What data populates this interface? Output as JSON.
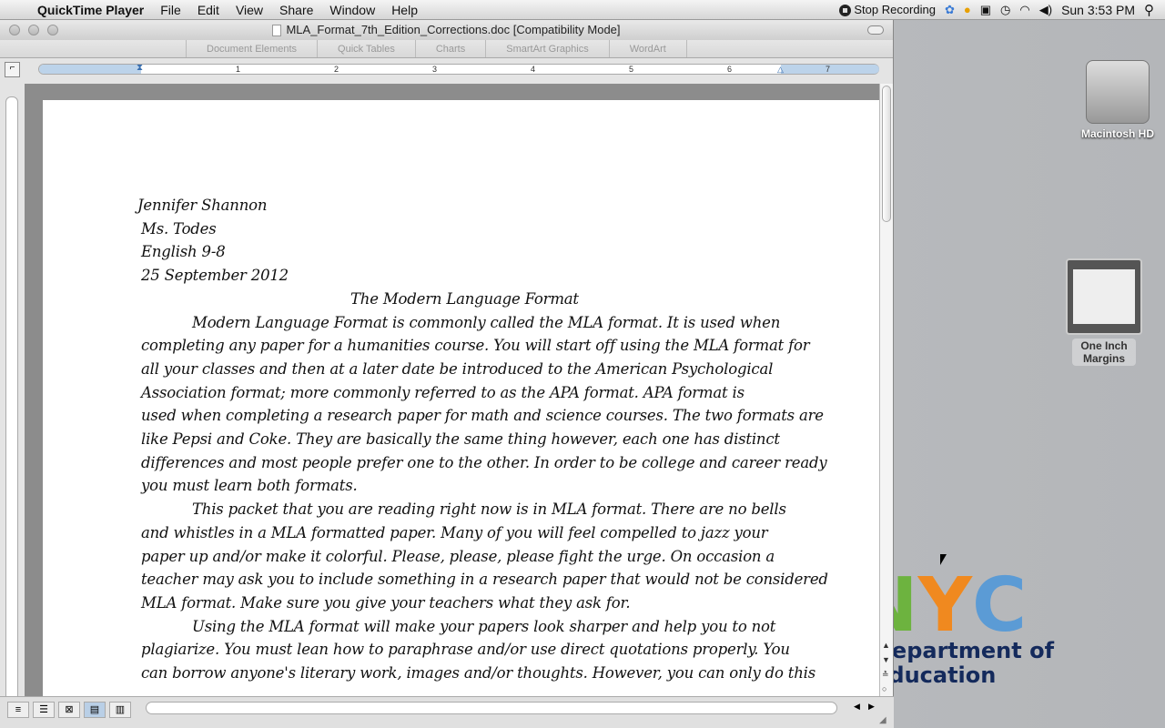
{
  "menubar": {
    "app": "QuickTime Player",
    "items": [
      "File",
      "Edit",
      "View",
      "Share",
      "Window",
      "Help"
    ],
    "stop_recording": "Stop Recording",
    "clock": "Sun 3:53 PM"
  },
  "window": {
    "title": "MLA_Format_7th_Edition_Corrections.doc [Compatibility Mode]",
    "ribbon_tabs": [
      "Document Elements",
      "Quick Tables",
      "Charts",
      "SmartArt Graphics",
      "WordArt"
    ],
    "ruler_numbers": [
      "1",
      "2",
      "3",
      "4",
      "5",
      "6",
      "7"
    ]
  },
  "document": {
    "lines": [
      "Jennifer Shannon",
      "Ms. Todes",
      "English  9-8",
      "25 September 2012",
      "The Modern Language Format",
      "Modern Language Format is commonly called the MLA format.  It is used when",
      "completing any paper for a humanities course.  You will start off using the MLA format for",
      "all your classes and then at a later date be introduced to the American Psychological",
      "Association format; more commonly referred to as the APA format.  APA format is",
      "used when completing a research paper for math and science courses.   The two formats are",
      "like Pepsi and Coke.  They are basically the same thing however, each one has distinct",
      "differences and most people prefer one to the other.  In order to be college and career ready",
      "you must learn both formats.",
      "This packet that you are reading right now is in MLA format.  There are no bells",
      "and whistles in a MLA formatted paper.   Many of you will feel compelled to jazz your",
      "paper up and/or make it colorful.  Please, please, please fight the urge.  On occasion a",
      "teacher may ask you to include something in a research paper that would not be considered",
      "MLA format.  Make sure you give your teachers what they ask for.",
      "Using the MLA format will make your papers look sharper and help you to not",
      "plagiarize. You must lean how to paraphrase and/or use direct quotations properly.  You",
      "can borrow anyone's literary work, images and/or thoughts.  However, you can only do this"
    ]
  },
  "desktop": {
    "hd": "Macintosh HD",
    "file": "One Inch Margins",
    "nyc": {
      "letters": [
        "N",
        "Y",
        "C"
      ],
      "colors": [
        "#6db33f",
        "#f0891f",
        "#5b9bd5"
      ],
      "line1": "Department of",
      "line2": "Education"
    }
  }
}
